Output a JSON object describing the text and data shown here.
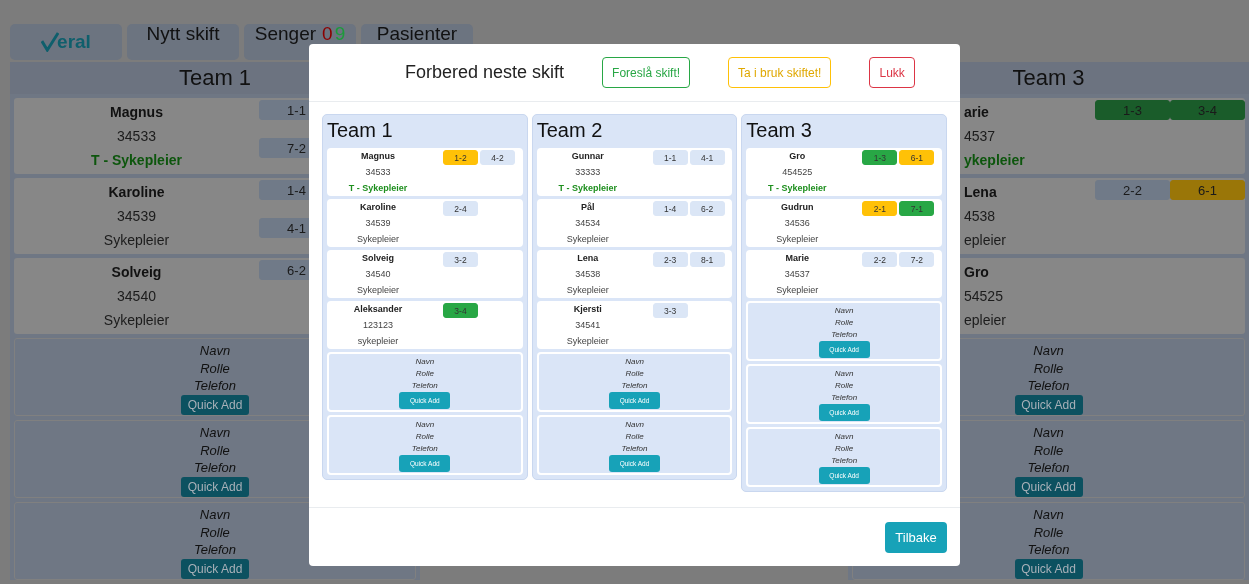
{
  "nav": {
    "logo_text": "eral",
    "tabs": [
      {
        "label": "Nytt skift"
      },
      {
        "label": "Senger",
        "counts": [
          {
            "text": "0",
            "color": "#8b0000"
          },
          {
            "text": "9",
            "color": "#1c9a3a"
          }
        ]
      },
      {
        "label": "Pasienter"
      }
    ]
  },
  "background_teams": [
    {
      "title": "Team 1",
      "members": [
        {
          "name": "Magnus",
          "number": "34533",
          "role": "T - Sykepleier",
          "leader": true,
          "beds": [
            {
              "label": "1-1",
              "color": "#707a88"
            },
            {
              "label": "7-2",
              "color": "#707a88"
            }
          ]
        },
        {
          "name": "Karoline",
          "number": "34539",
          "role": "Sykepleier",
          "leader": false,
          "beds": [
            {
              "label": "1-4",
              "color": "#707a88"
            },
            {
              "label": "4-1",
              "color": "#707a88"
            }
          ]
        },
        {
          "name": "Solveig",
          "number": "34540",
          "role": "Sykepleier",
          "leader": false,
          "beds": [
            {
              "label": "6-2",
              "color": "#707a88"
            }
          ]
        }
      ],
      "empty_slots": [
        {
          "fields": [
            "Navn",
            "Rolle",
            "Telefon"
          ],
          "button": "Quick Add"
        },
        {
          "fields": [
            "Navn",
            "Rolle",
            "Telefon"
          ],
          "button": "Quick Add"
        },
        {
          "fields": [
            "Navn",
            "Rolle",
            "Telefon"
          ],
          "button": "Quick Add"
        }
      ]
    },
    {
      "title": "Team 3",
      "members": [
        {
          "name": "arie",
          "number": "4537",
          "role": "ykepleier",
          "leader": true,
          "beds": [
            {
              "label": "1-3",
              "color": "#1a5c2a"
            },
            {
              "label": "3-4",
              "color": "#1a5c2a"
            }
          ]
        },
        {
          "name": "Lena",
          "number": "4538",
          "role": "epleier",
          "leader": false,
          "beds": [
            {
              "label": "2-2",
              "color": "#707a88"
            },
            {
              "label": "6-1",
              "color": "#9a7608"
            }
          ]
        },
        {
          "name": "Gro",
          "number": "54525",
          "role": "epleier",
          "leader": false
        }
      ],
      "empty_slots": [
        {
          "fields": [
            "Navn",
            "Rolle",
            "Telefon"
          ],
          "button": "Quick Add"
        },
        {
          "fields": [
            "Navn",
            "Rolle",
            "Telefon"
          ],
          "button": "Quick Add"
        },
        {
          "fields": [
            "Navn",
            "Rolle",
            "Telefon"
          ],
          "button": "Quick Add"
        }
      ]
    }
  ],
  "modal": {
    "title": "Forbered neste skift",
    "actions": [
      {
        "label": "Foreslå skift!",
        "kind": "success"
      },
      {
        "label": "Ta i bruk skiftet!",
        "kind": "warning"
      },
      {
        "label": "Lukk",
        "kind": "danger"
      }
    ],
    "teams": [
      {
        "title": "Team 1",
        "members": [
          {
            "name": "Magnus",
            "number": "34533",
            "role": "T - Sykepleier",
            "leader": true,
            "beds": [
              {
                "label": "1-2",
                "color": "#ffc107"
              },
              {
                "label": "4-2",
                "color": "#dbe6f6"
              }
            ]
          },
          {
            "name": "Karoline",
            "number": "34539",
            "role": "Sykepleier",
            "leader": false,
            "beds": [
              {
                "label": "2-4",
                "color": "#dbe6f6"
              }
            ]
          },
          {
            "name": "Solveig",
            "number": "34540",
            "role": "Sykepleier",
            "leader": false,
            "beds": [
              {
                "label": "3-2",
                "color": "#dbe6f6"
              }
            ]
          },
          {
            "name": "Aleksander",
            "number": "123123",
            "role": "sykepleier",
            "leader": false,
            "beds": [
              {
                "label": "3-4",
                "color": "#28a745"
              }
            ]
          }
        ],
        "empty_slots": [
          {
            "fields": [
              "Navn",
              "Rolle",
              "Telefon"
            ],
            "button": "Quick Add"
          },
          {
            "fields": [
              "Navn",
              "Rolle",
              "Telefon"
            ],
            "button": "Quick Add"
          }
        ]
      },
      {
        "title": "Team 2",
        "members": [
          {
            "name": "Gunnar",
            "number": "33333",
            "role": "T - Sykepleier",
            "leader": true,
            "beds": [
              {
                "label": "1-1",
                "color": "#dbe6f6"
              },
              {
                "label": "4-1",
                "color": "#dbe6f6"
              }
            ]
          },
          {
            "name": "Pål",
            "number": "34534",
            "role": "Sykepleier",
            "leader": false,
            "beds": [
              {
                "label": "1-4",
                "color": "#dbe6f6"
              },
              {
                "label": "6-2",
                "color": "#dbe6f6"
              }
            ]
          },
          {
            "name": "Lena",
            "number": "34538",
            "role": "Sykepleier",
            "leader": false,
            "beds": [
              {
                "label": "2-3",
                "color": "#dbe6f6"
              },
              {
                "label": "8-1",
                "color": "#dbe6f6"
              }
            ]
          },
          {
            "name": "Kjersti",
            "number": "34541",
            "role": "Sykepleier",
            "leader": false,
            "beds": [
              {
                "label": "3-3",
                "color": "#dbe6f6"
              }
            ]
          }
        ],
        "empty_slots": [
          {
            "fields": [
              "Navn",
              "Rolle",
              "Telefon"
            ],
            "button": "Quick Add"
          },
          {
            "fields": [
              "Navn",
              "Rolle",
              "Telefon"
            ],
            "button": "Quick Add"
          }
        ]
      },
      {
        "title": "Team 3",
        "members": [
          {
            "name": "Gro",
            "number": "454525",
            "role": "T - Sykepleier",
            "leader": true,
            "beds": [
              {
                "label": "1-3",
                "color": "#28a745"
              },
              {
                "label": "6-1",
                "color": "#ffc107"
              }
            ]
          },
          {
            "name": "Gudrun",
            "number": "34536",
            "role": "Sykepleier",
            "leader": false,
            "beds": [
              {
                "label": "2-1",
                "color": "#ffc107"
              },
              {
                "label": "7-1",
                "color": "#28a745"
              }
            ]
          },
          {
            "name": "Marie",
            "number": "34537",
            "role": "Sykepleier",
            "leader": false,
            "beds": [
              {
                "label": "2-2",
                "color": "#dbe6f6"
              },
              {
                "label": "7-2",
                "color": "#dbe6f6"
              }
            ]
          }
        ],
        "empty_slots": [
          {
            "fields": [
              "Navn",
              "Rolle",
              "Telefon"
            ],
            "button": "Quick Add"
          },
          {
            "fields": [
              "Navn",
              "Rolle",
              "Telefon"
            ],
            "button": "Quick Add"
          },
          {
            "fields": [
              "Navn",
              "Rolle",
              "Telefon"
            ],
            "button": "Quick Add"
          }
        ]
      }
    ],
    "footer_button": "Tilbake"
  }
}
